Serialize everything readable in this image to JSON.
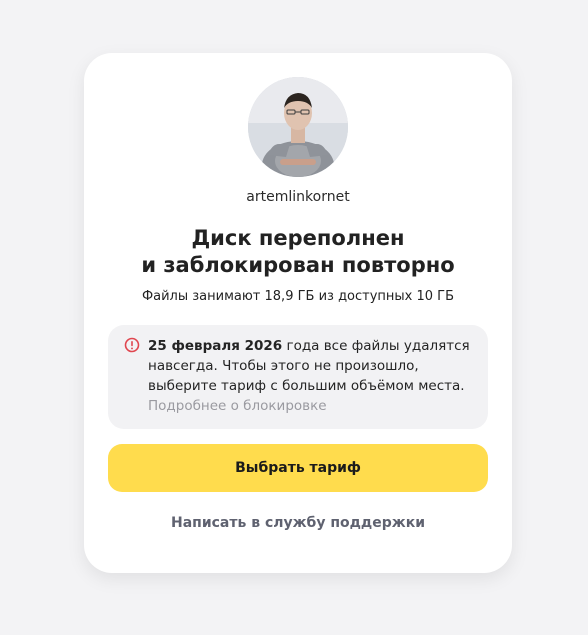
{
  "profile": {
    "username": "artemlinkornet"
  },
  "header": {
    "title_line_1": "Диск переполнен",
    "title_line_2": "и заблокирован повторно",
    "subtitle": "Файлы занимают 18,9 ГБ из доступных 10 ГБ"
  },
  "warning": {
    "date": "25 февраля 2026",
    "message": " года все файлы удалятся навсегда. Чтобы этого не произошло, выберите тариф с большим объёмом места. ",
    "link_label": "Подробнее о блокировке",
    "icon": "alert-circle-icon",
    "accent_color": "#e0464f"
  },
  "actions": {
    "primary_label": "Выбрать тариф",
    "secondary_label": "Написать в службу поддержки"
  },
  "colors": {
    "background": "#f3f3f5",
    "card": "#ffffff",
    "primary_button": "#ffdc4d",
    "warning_background": "#f2f2f4"
  }
}
